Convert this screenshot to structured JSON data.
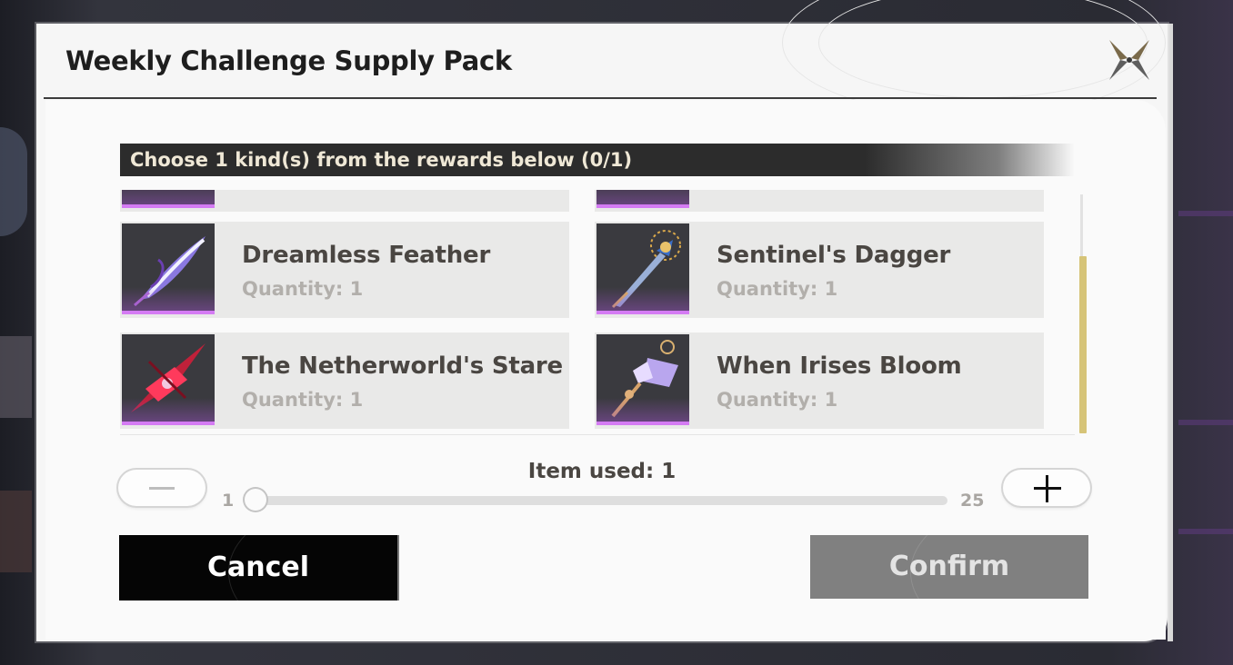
{
  "dialog": {
    "title": "Weekly Challenge Supply Pack",
    "close_icon": "close-x-icon",
    "instruction": "Choose 1 kind(s) from the rewards below (0/1)"
  },
  "rewards": [
    {
      "name": "Dreamless Feather",
      "quantity": "Quantity: 1",
      "icon": "purple-feather-icon"
    },
    {
      "name": "Sentinel's Dagger",
      "quantity": "Quantity: 1",
      "icon": "golden-dagger-icon"
    },
    {
      "name": "The Netherworld's Stare",
      "quantity": "Quantity: 1",
      "icon": "crimson-eye-icon"
    },
    {
      "name": "When Irises Bloom",
      "quantity": "Quantity: 1",
      "icon": "iris-pendant-icon"
    }
  ],
  "usage": {
    "label": "Item used: 1",
    "min": "1",
    "max": "25",
    "value": 1
  },
  "buttons": {
    "cancel": "Cancel",
    "confirm": "Confirm"
  },
  "colors": {
    "rarity": "#d47bf3",
    "scroll_accent": "#d6c478",
    "title_bar": "#2c2c2c"
  }
}
